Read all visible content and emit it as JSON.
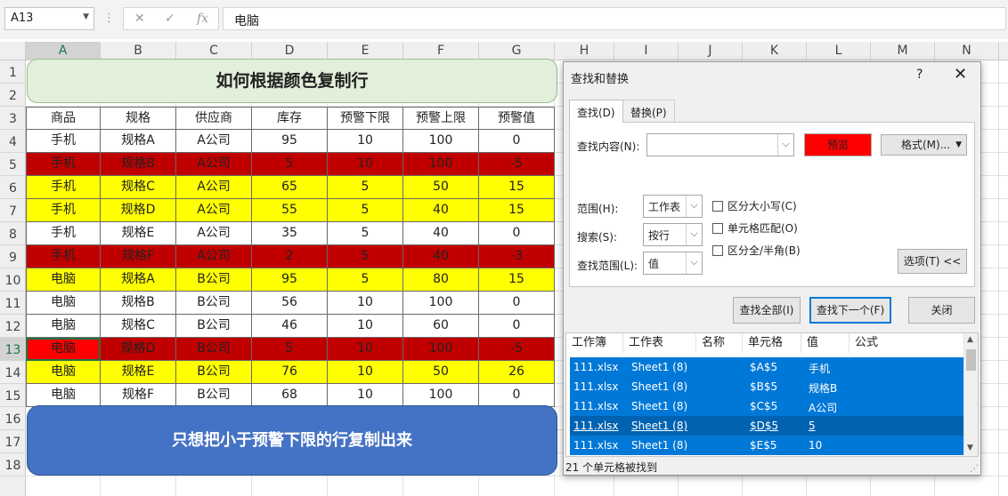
{
  "formula_bar": {
    "name_box": "A13",
    "cancel_glyph": "✕",
    "enter_glyph": "✓",
    "fx_glyph": "fx",
    "value": "电脑"
  },
  "columns": [
    "A",
    "B",
    "C",
    "D",
    "E",
    "F",
    "G",
    "H",
    "I",
    "J",
    "K",
    "L",
    "M",
    "N"
  ],
  "rows": [
    "1",
    "2",
    "3",
    "4",
    "5",
    "6",
    "7",
    "8",
    "9",
    "10",
    "11",
    "12",
    "13",
    "14",
    "15",
    "16",
    "17",
    "18"
  ],
  "selected_row": "13",
  "selected_col": "A",
  "sheet": {
    "title": "如何根据颜色复制行",
    "headers": [
      "商品",
      "规格",
      "供应商",
      "库存",
      "预警下限",
      "预警上限",
      "预警值"
    ],
    "data": [
      {
        "cells": [
          "手机",
          "规格A",
          "A公司",
          "95",
          "10",
          "100",
          "0"
        ],
        "fill": "#ffffff"
      },
      {
        "cells": [
          "手机",
          "规格B",
          "A公司",
          "5",
          "10",
          "100",
          "-5"
        ],
        "fill": "#c00000"
      },
      {
        "cells": [
          "手机",
          "规格C",
          "A公司",
          "65",
          "5",
          "50",
          "15"
        ],
        "fill": "#ffff00"
      },
      {
        "cells": [
          "手机",
          "规格D",
          "A公司",
          "55",
          "5",
          "40",
          "15"
        ],
        "fill": "#ffff00"
      },
      {
        "cells": [
          "手机",
          "规格E",
          "A公司",
          "35",
          "5",
          "40",
          "0"
        ],
        "fill": "#ffffff"
      },
      {
        "cells": [
          "手机",
          "规格F",
          "A公司",
          "2",
          "5",
          "40",
          "-3"
        ],
        "fill": "#c00000"
      },
      {
        "cells": [
          "电脑",
          "规格A",
          "B公司",
          "95",
          "5",
          "80",
          "15"
        ],
        "fill": "#ffff00"
      },
      {
        "cells": [
          "电脑",
          "规格B",
          "B公司",
          "56",
          "10",
          "100",
          "0"
        ],
        "fill": "#ffffff"
      },
      {
        "cells": [
          "电脑",
          "规格C",
          "B公司",
          "46",
          "10",
          "60",
          "0"
        ],
        "fill": "#ffffff"
      },
      {
        "cells": [
          "电脑",
          "规格D",
          "B公司",
          "5",
          "10",
          "100",
          "-5"
        ],
        "fill": "#c00000"
      },
      {
        "cells": [
          "电脑",
          "规格E",
          "B公司",
          "76",
          "10",
          "50",
          "26"
        ],
        "fill": "#ffff00"
      },
      {
        "cells": [
          "电脑",
          "规格F",
          "B公司",
          "68",
          "10",
          "100",
          "0"
        ],
        "fill": "#ffffff"
      }
    ],
    "note": "只想把小于预警下限的行复制出来"
  },
  "dialog": {
    "title": "查找和替换",
    "help": "?",
    "close": "✕",
    "tab_find": "查找(D)",
    "tab_replace": "替换(P)",
    "find_label": "查找内容(N):",
    "find_value": "",
    "preview_label": "预览",
    "preview_color": "#ff0000",
    "format_button": "格式(M)...",
    "scope_label": "范围(H):",
    "scope_value": "工作表",
    "search_label": "搜索(S):",
    "search_value": "按行",
    "lookin_label": "查找范围(L):",
    "lookin_value": "值",
    "match_case": "区分大小写(C)",
    "match_cell": "单元格匹配(O)",
    "match_width": "区分全/半角(B)",
    "options_button": "选项(T) <<",
    "find_all": "查找全部(I)",
    "find_next": "查找下一个(F)",
    "close_button": "关闭",
    "result_headers": [
      "工作簿",
      "工作表",
      "名称",
      "单元格",
      "值",
      "公式"
    ],
    "results": [
      [
        "111.xlsx",
        "Sheet1 (8)",
        "",
        "$A$5",
        "手机",
        ""
      ],
      [
        "111.xlsx",
        "Sheet1 (8)",
        "",
        "$B$5",
        "规格B",
        ""
      ],
      [
        "111.xlsx",
        "Sheet1 (8)",
        "",
        "$C$5",
        "A公司",
        ""
      ],
      [
        "111.xlsx",
        "Sheet1 (8)",
        "",
        "$D$5",
        "5",
        ""
      ],
      [
        "111.xlsx",
        "Sheet1 (8)",
        "",
        "$E$5",
        "10",
        ""
      ]
    ],
    "status": "21 个单元格被找到"
  },
  "colors": {
    "excel_green": "#217346",
    "selection_blue": "#0078d7",
    "banner_blue": "#4472c4",
    "banner_green": "#e2efda"
  }
}
